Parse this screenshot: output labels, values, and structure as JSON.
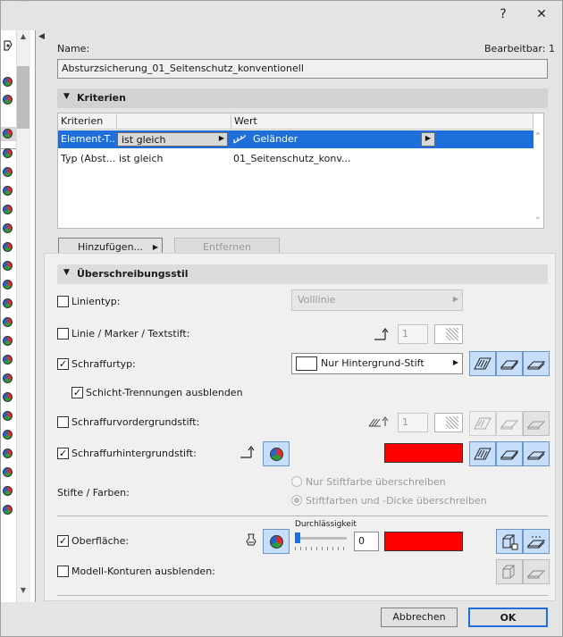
{
  "window": {
    "title_ghost": "...",
    "help_label": "?",
    "close_label": "✕"
  },
  "colors": {
    "accent": "#1e6fd9",
    "selection_bg": "#1e6fd9",
    "surface_red": "#ff0000",
    "toggle_on": "#c7defa"
  },
  "name": {
    "label": "Name:",
    "editable_label": "Bearbeitbar: 1",
    "value": "Absturzsicherung_01_Seitenschutz_konventionell"
  },
  "criteria": {
    "section_title": "Kriterien",
    "columns": [
      "Kriterien",
      "",
      "Wert"
    ],
    "rows": [
      {
        "criterion": "Element-T...",
        "operator": "ist gleich",
        "value": "Geländer",
        "selected": true
      },
      {
        "criterion": "Typ (Abst...",
        "operator": "ist gleich",
        "value": "01_Seitenschutz_konv...",
        "selected": false
      }
    ],
    "add_button": "Hinzufügen...",
    "remove_button": "Entfernen"
  },
  "override": {
    "section_title": "Überschreibungsstil",
    "linetype": {
      "label": "Linientyp:",
      "checked": false,
      "dropdown": "Volllinie"
    },
    "line_marker": {
      "label": "Linie / Marker / Textstift:",
      "checked": false,
      "pen_number": "1"
    },
    "fill_type": {
      "label": "Schraffurtyp:",
      "checked": true,
      "dropdown": "Nur Hintergrund-Stift"
    },
    "hide_layer_sep": {
      "label": "Schicht-Trennungen ausblenden",
      "checked": true
    },
    "fill_fg_pen": {
      "label": "Schraffurvordergrundstift:",
      "checked": false,
      "pen_number": "1"
    },
    "fill_bg_pen": {
      "label": "Schraffurhintergrundstift:",
      "checked": true,
      "color": "#ff0000"
    },
    "pens_colors": {
      "label": "Stifte / Farben:",
      "option1": "Nur Stiftfarbe überschreiben",
      "option2": "Stiftfarben und -Dicke überschreiben",
      "selected": 2
    },
    "transparency": {
      "label": "Durchlässigkeit",
      "value": "0",
      "level": 0
    },
    "surface": {
      "label": "Oberfläche:",
      "checked": true,
      "color": "#ff0000"
    },
    "hide_contours": {
      "label": "Modell-Konturen ausblenden:",
      "checked": false
    }
  },
  "footer": {
    "cancel": "Abbrechen",
    "ok": "OK"
  }
}
